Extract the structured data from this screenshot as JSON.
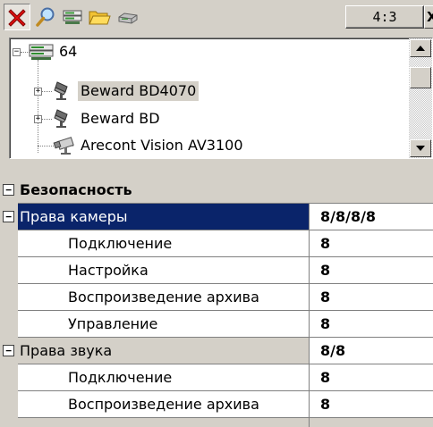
{
  "toolbar": {
    "buttons": [
      {
        "name": "delete-icon",
        "label": ""
      },
      {
        "name": "search-icon",
        "label": ""
      },
      {
        "name": "server-icon",
        "label": ""
      },
      {
        "name": "folder-icon",
        "label": ""
      },
      {
        "name": "device-icon",
        "label": ""
      }
    ],
    "aspect_ratio": "4:3",
    "close_glyph": "X"
  },
  "tree": {
    "root": {
      "label": "64",
      "expanded": true
    },
    "children": [
      {
        "label": "Beward BD4070",
        "expandable": true,
        "selected": true
      },
      {
        "label": "Beward BD",
        "expandable": true,
        "selected": false
      },
      {
        "label": "Arecont Vision AV3100",
        "expandable": false,
        "selected": false
      }
    ]
  },
  "grid": {
    "category": "Безопасность",
    "camera_rights": {
      "label": "Права камеры",
      "value": "8/8/8/8",
      "items": [
        {
          "label": "Подключение",
          "value": "8"
        },
        {
          "label": "Настройка",
          "value": "8"
        },
        {
          "label": "Воспроизведение архива",
          "value": "8"
        },
        {
          "label": "Управление",
          "value": "8"
        }
      ]
    },
    "sound_rights": {
      "label": "Права звука",
      "value": "8/8",
      "items": [
        {
          "label": "Подключение",
          "value": "8"
        },
        {
          "label": "Воспроизведение архива",
          "value": "8"
        }
      ]
    },
    "expander_glyph": "−"
  },
  "colors": {
    "window_bg": "#d4d0c8",
    "selection_bg": "#0a246a",
    "selection_fg": "#ffffff"
  }
}
